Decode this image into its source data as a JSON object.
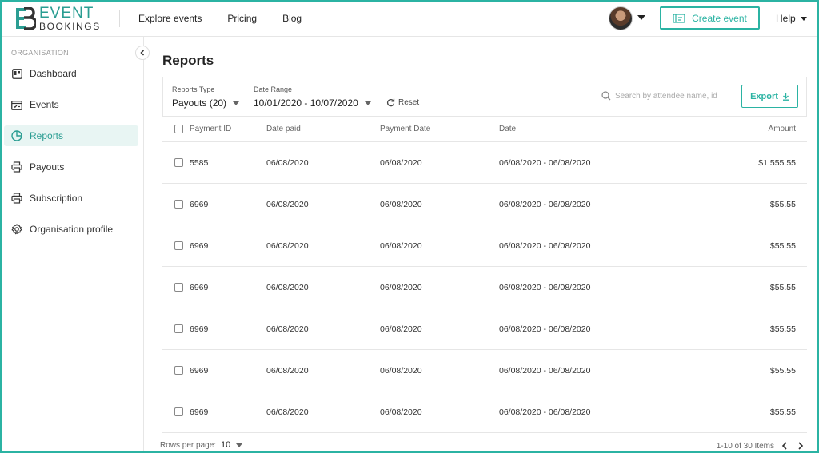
{
  "brand": {
    "line1": "EVENT",
    "line2": "BOOKINGS",
    "accent_color": "#2bb3a3"
  },
  "nav": {
    "items": [
      "Explore events",
      "Pricing",
      "Blog"
    ],
    "create_event_label": "Create event",
    "help_label": "Help"
  },
  "sidebar": {
    "section_label": "ORGANISATION",
    "items": [
      {
        "label": "Dashboard",
        "icon": "dashboard-icon"
      },
      {
        "label": "Events",
        "icon": "calendar-icon"
      },
      {
        "label": "Reports",
        "icon": "pie-chart-icon",
        "active": true
      },
      {
        "label": "Payouts",
        "icon": "printer-icon"
      },
      {
        "label": "Subscription",
        "icon": "printer-icon"
      },
      {
        "label": "Organisation profile",
        "icon": "gear-icon"
      }
    ]
  },
  "page": {
    "title": "Reports"
  },
  "filters": {
    "reports_type_label": "Reports Type",
    "reports_type_value": "Payouts (20)",
    "date_range_label": "Date Range",
    "date_range_value": "10/01/2020 - 10/07/2020",
    "reset_label": "Reset",
    "search_placeholder": "Search by attendee name, id",
    "export_label": "Export"
  },
  "table": {
    "columns": [
      "Payment ID",
      "Date paid",
      "Payment Date",
      "Date",
      "Amount"
    ],
    "rows": [
      [
        "5585",
        "06/08/2020",
        "06/08/2020",
        "06/08/2020 - 06/08/2020",
        "$1,555.55"
      ],
      [
        "6969",
        "06/08/2020",
        "06/08/2020",
        "06/08/2020 - 06/08/2020",
        "$55.55"
      ],
      [
        "6969",
        "06/08/2020",
        "06/08/2020",
        "06/08/2020 - 06/08/2020",
        "$55.55"
      ],
      [
        "6969",
        "06/08/2020",
        "06/08/2020",
        "06/08/2020 - 06/08/2020",
        "$55.55"
      ],
      [
        "6969",
        "06/08/2020",
        "06/08/2020",
        "06/08/2020 - 06/08/2020",
        "$55.55"
      ],
      [
        "6969",
        "06/08/2020",
        "06/08/2020",
        "06/08/2020 - 06/08/2020",
        "$55.55"
      ],
      [
        "6969",
        "06/08/2020",
        "06/08/2020",
        "06/08/2020 - 06/08/2020",
        "$55.55"
      ]
    ]
  },
  "pagination": {
    "rows_per_page_label": "Rows per page:",
    "rows_per_page_value": "10",
    "range_text": "1-10 of 30 Items"
  }
}
